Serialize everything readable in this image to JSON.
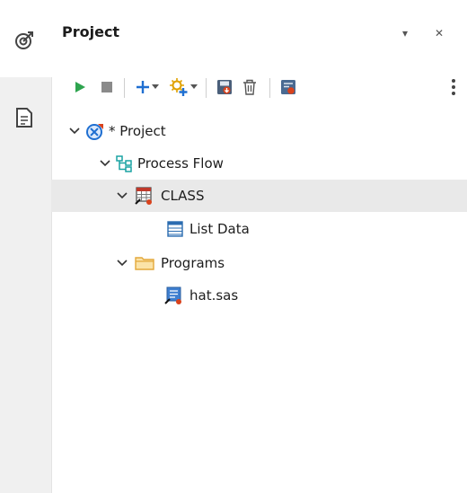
{
  "panel": {
    "title": "Project",
    "menu_glyph": "▾",
    "close_glyph": "✕"
  },
  "toolbar": {
    "icons": [
      "run-icon",
      "stop-icon",
      "add-icon",
      "dropdown-arrow-icon",
      "new-task-icon",
      "dropdown-arrow-icon",
      "save-icon",
      "delete-icon",
      "properties-icon",
      "more-icon"
    ]
  },
  "tree": {
    "project": {
      "label": "* Project",
      "icon": "project-icon"
    },
    "process_flow": {
      "label": "Process Flow",
      "icon": "process-flow-icon"
    },
    "class": {
      "label": "CLASS",
      "icon": "table-icon"
    },
    "list_data": {
      "label": "List Data",
      "icon": "list-data-icon"
    },
    "programs": {
      "label": "Programs",
      "icon": "folder-icon"
    },
    "hat_sas": {
      "label": "hat.sas",
      "icon": "sas-program-icon"
    }
  },
  "colors": {
    "accent_blue": "#1f6fd1",
    "run_green": "#2ea44f",
    "selection": "#e9e9e9",
    "folder": "#f2b84b"
  }
}
